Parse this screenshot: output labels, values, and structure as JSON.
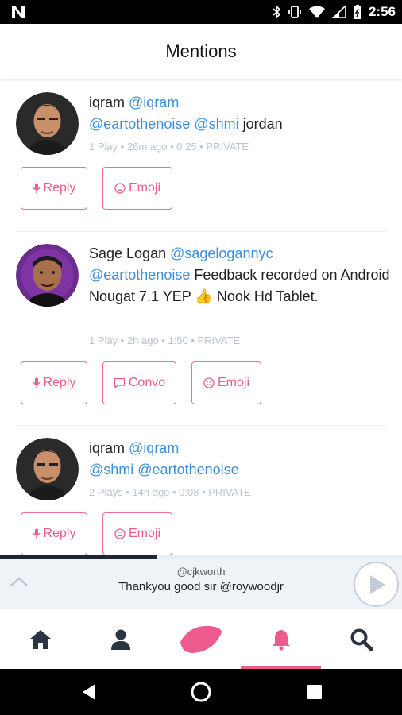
{
  "status_bar": {
    "time": "2:56"
  },
  "header": {
    "title": "Mentions"
  },
  "posts": [
    {
      "author": "iqram",
      "handle": "@iqram",
      "mentions": "@eartothenoise @shmi",
      "text": " jordan",
      "meta": "1 Play • 26m ago • 0:25 • PRIVATE",
      "actions": [
        "Reply",
        "Emoji"
      ]
    },
    {
      "author": "Sage Logan",
      "handle": "@sagelogannyc",
      "mentions": "@eartothenoise",
      "text": " Feedback recorded on Android Nougat 7.1 YEP 👍 Nook Hd Tablet.",
      "meta": "1 Play • 2h ago • 1:50 • PRIVATE",
      "actions": [
        "Reply",
        "Convo",
        "Emoji"
      ]
    },
    {
      "author": "iqram",
      "handle": "@iqram",
      "mentions": "@shmi @eartothenoise",
      "text": "",
      "meta": "2 Plays • 14h ago • 0:08 • PRIVATE",
      "actions": [
        "Reply",
        "Emoji"
      ]
    }
  ],
  "player": {
    "user": "@cjkworth",
    "caption": "Thankyou good sir @roywoodjr",
    "progress": 0.39
  },
  "nav": {
    "items": [
      "home-icon",
      "profile-icon",
      "record-icon",
      "notifications-icon",
      "search-icon"
    ],
    "active": "notifications-icon"
  },
  "colors": {
    "accent": "#ec5a8e",
    "link": "#3b8fd9",
    "meta": "#b9c4d0"
  }
}
